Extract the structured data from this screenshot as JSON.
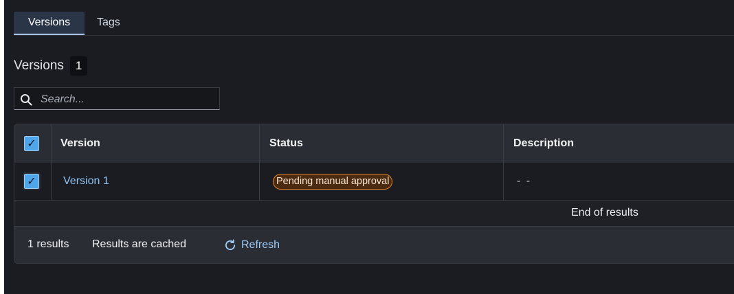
{
  "tabs": [
    {
      "label": "Versions",
      "active": true
    },
    {
      "label": "Tags",
      "active": false
    }
  ],
  "section": {
    "title": "Versions",
    "count": "1"
  },
  "search": {
    "placeholder": "Search...",
    "value": "",
    "icon": "search-icon"
  },
  "table": {
    "columns": [
      "Version",
      "Status",
      "Description"
    ],
    "header_checkbox": "✓",
    "rows": [
      {
        "checked": "✓",
        "version": "Version 1",
        "status": "Pending manual approval",
        "description": "- -"
      }
    ],
    "end_of_results": "End of results"
  },
  "footer": {
    "results_count": "1 results",
    "cache_status": "Results are cached",
    "refresh_label": "Refresh",
    "refresh_icon": "refresh-icon"
  },
  "colors": {
    "background": "#1b1c21",
    "accent_link": "#8fc3f2",
    "checkbox": "#4ea6e8",
    "status_pending": "#e0832a"
  }
}
